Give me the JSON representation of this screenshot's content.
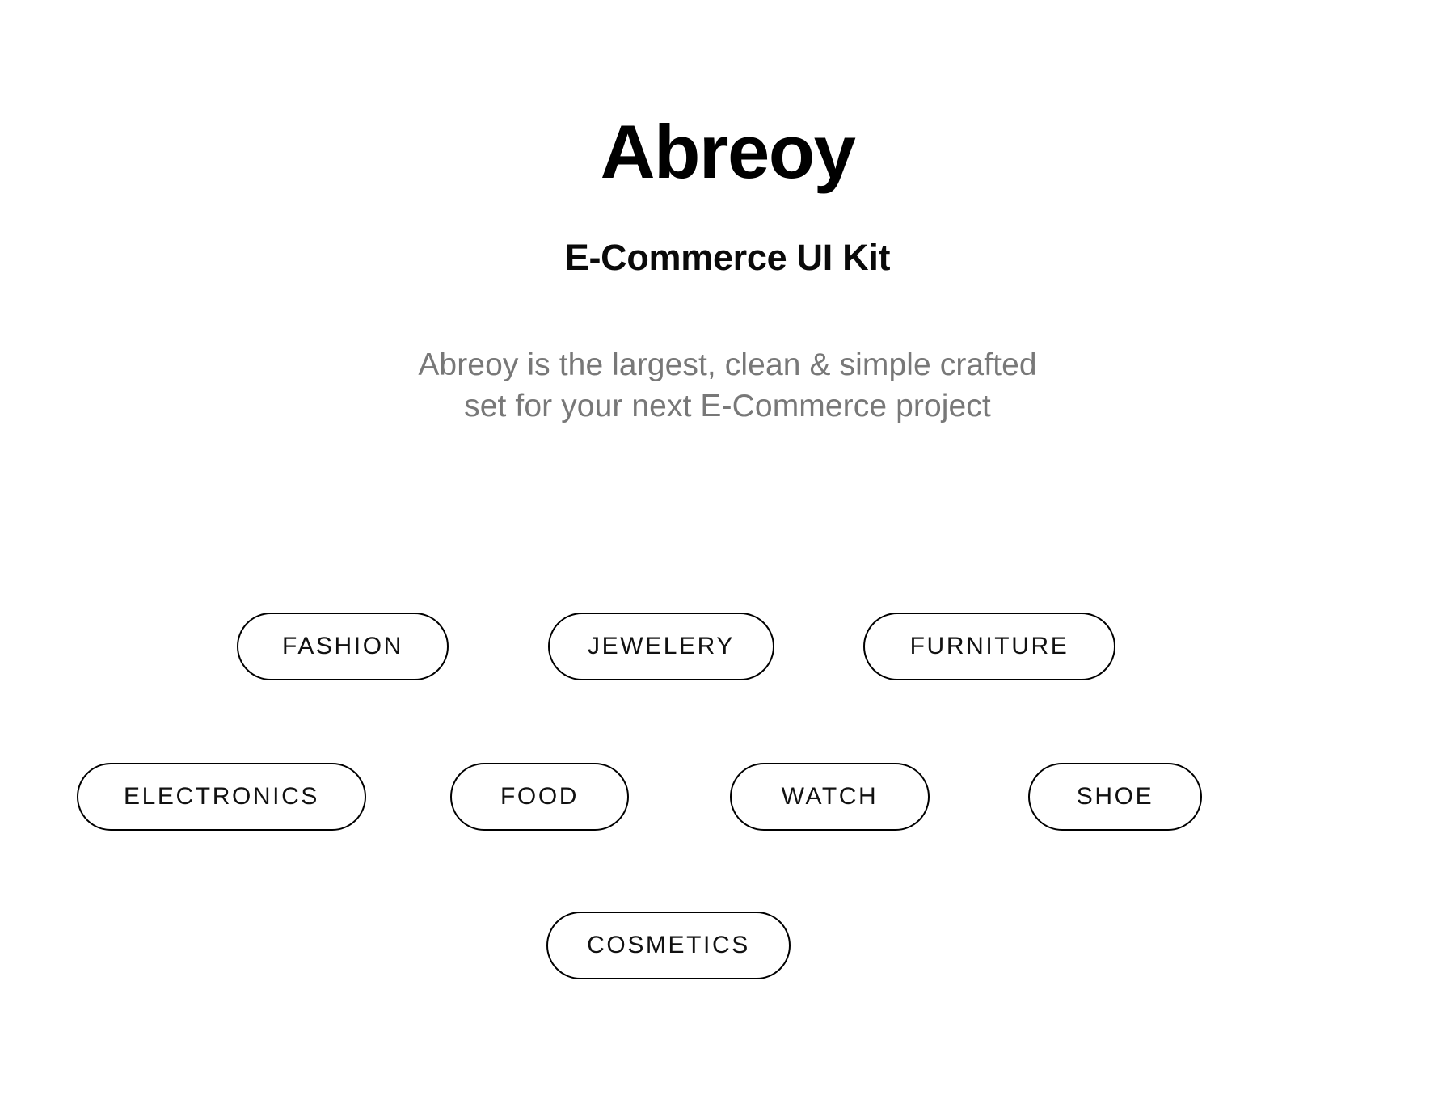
{
  "header": {
    "brand_title": "Abreoy",
    "subtitle": "E-Commerce UI Kit",
    "description": "Abreoy is the largest, clean & simple crafted\nset for your next  E-Commerce  project"
  },
  "colors": {
    "background": "#ffffff",
    "title_color": "#000000",
    "subtitle_color": "#0a0a0a",
    "description_color": "#787878",
    "pill_border": "#000000",
    "pill_text": "#111111"
  },
  "categories": {
    "rows": [
      {
        "items": [
          {
            "label": "FASHION"
          },
          {
            "label": "JEWELERY"
          },
          {
            "label": "FURNITURE"
          }
        ]
      },
      {
        "items": [
          {
            "label": "ELECTRONICS"
          },
          {
            "label": "FOOD"
          },
          {
            "label": "WATCH"
          },
          {
            "label": "SHOE"
          }
        ]
      },
      {
        "items": [
          {
            "label": "COSMETICS"
          }
        ]
      }
    ]
  }
}
